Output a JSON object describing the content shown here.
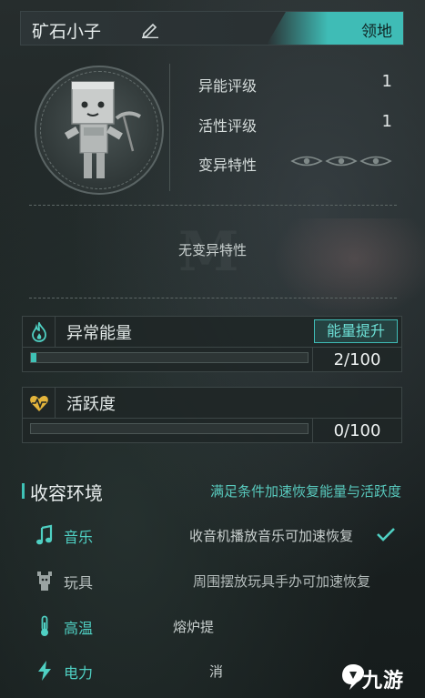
{
  "header": {
    "name": "矿石小子",
    "tab_label": "领地"
  },
  "stats": [
    {
      "label": "异能评级",
      "value": "1"
    },
    {
      "label": "活性评级",
      "value": "1"
    },
    {
      "label": "变异特性",
      "value": ""
    }
  ],
  "trait_text": "无变异特性",
  "energy": {
    "title": "异常能量",
    "boost_label": "能量提升",
    "value_text": "2/100",
    "fraction": 0.02
  },
  "activity": {
    "title": "活跃度",
    "value_text": "0/100",
    "fraction": 0.0
  },
  "environment": {
    "title": "收容环境",
    "subtitle": "满足条件加速恢复能量与活跃度",
    "rows": [
      {
        "name": "音乐",
        "desc": "收音机播放音乐可加速恢复",
        "active": true
      },
      {
        "name": "玩具",
        "desc": "周围摆放玩具手办可加速恢复",
        "active": false
      },
      {
        "name": "高温",
        "desc": "熔炉提",
        "active": true
      },
      {
        "name": "电力",
        "desc": "消",
        "active": true
      }
    ]
  },
  "watermark": {
    "text": "九游"
  },
  "colors": {
    "accent": "#3fc2b6",
    "inactive": "#9aa3a2",
    "background": "#1c2222"
  }
}
